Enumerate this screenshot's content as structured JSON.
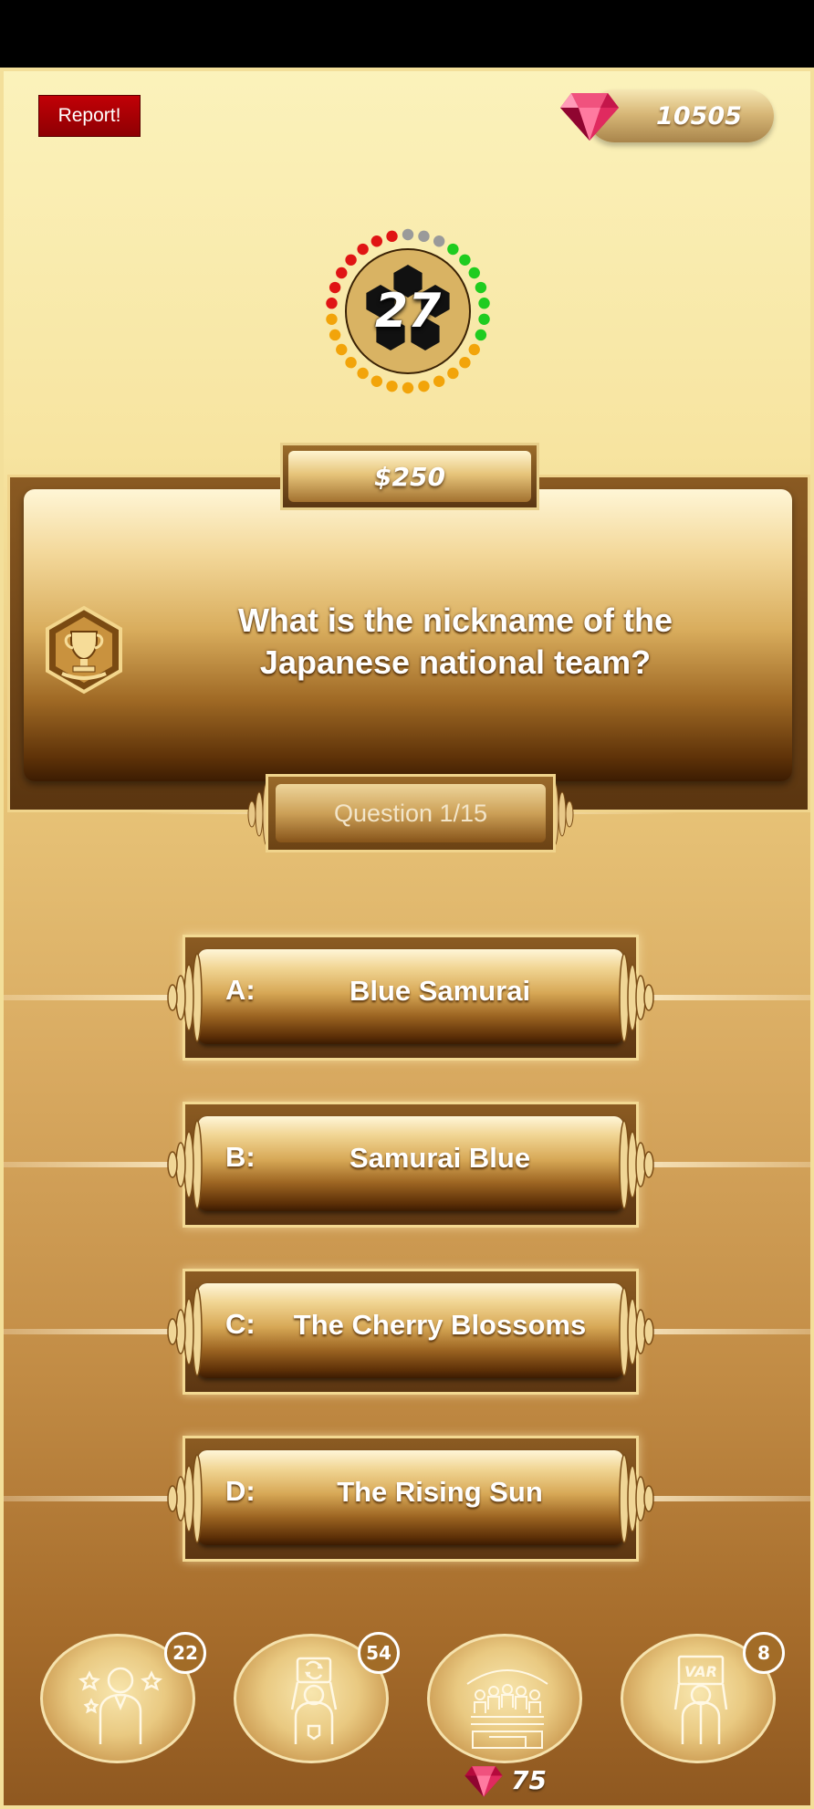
{
  "header": {
    "report_label": "Report!",
    "gems_count": "10505"
  },
  "timer": {
    "seconds": "27"
  },
  "question": {
    "prize": "$250",
    "text": "What is the nickname of the Japanese national team?",
    "counter": "Question 1/15"
  },
  "answers": [
    {
      "letter": "A:",
      "text": "Blue Samurai"
    },
    {
      "letter": "B:",
      "text": "Samurai Blue"
    },
    {
      "letter": "C:",
      "text": "The Cherry Blossoms"
    },
    {
      "letter": "D:",
      "text": "The Rising Sun"
    }
  ],
  "lifelines": [
    {
      "icon": "fan-vote-icon",
      "count": "22"
    },
    {
      "icon": "substitution-icon",
      "count": "54"
    },
    {
      "icon": "stadium-crowd-icon",
      "count": ""
    },
    {
      "icon": "var-referee-icon",
      "count": "8"
    }
  ],
  "lifeline_cost": "75",
  "colors": {
    "accent_gold": "#d7a856",
    "report_red": "#c10006",
    "gem": "#d0124b"
  }
}
